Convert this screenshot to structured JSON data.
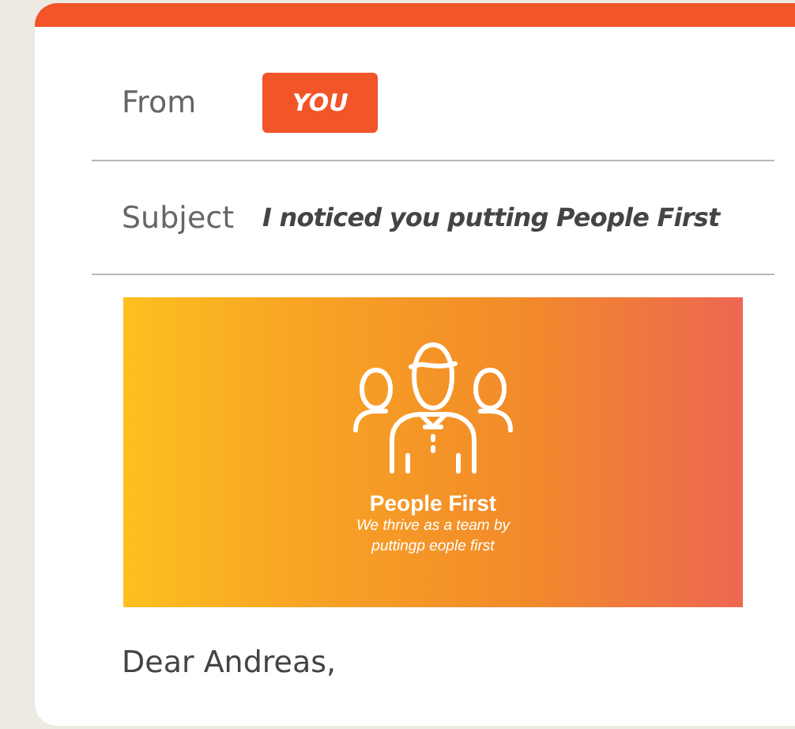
{
  "email": {
    "from_label": "From",
    "from_value": "YOU",
    "subject_label": "Subject",
    "subject": "I noticed you putting People First"
  },
  "banner": {
    "title": "People First",
    "tagline_lines": [
      "We thrive as a team by",
      "puttingp eople first"
    ]
  },
  "greeting": "Dear Andreas,"
}
